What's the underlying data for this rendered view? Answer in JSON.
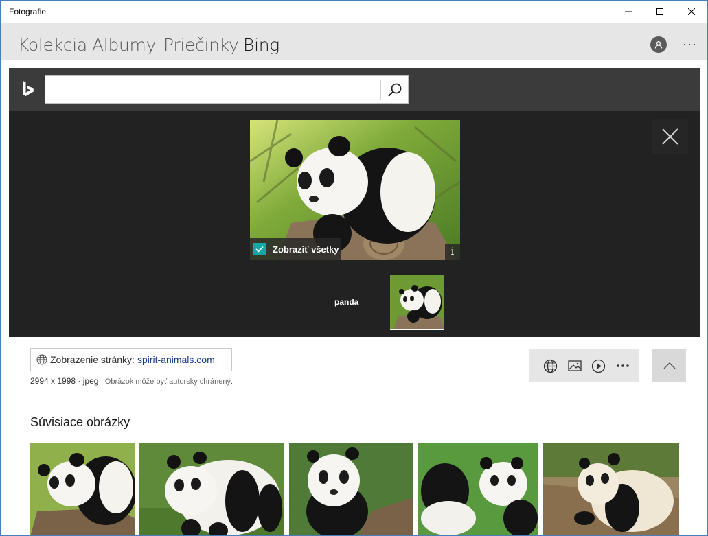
{
  "window": {
    "title": "Fotografie",
    "controls": [
      "minimize-icon",
      "maximize-icon",
      "close-icon"
    ]
  },
  "nav": {
    "tabs": [
      {
        "label": "Kolekcia",
        "active": false
      },
      {
        "label": "Albumy",
        "active": false
      },
      {
        "label": "Priečinky",
        "active": false
      },
      {
        "label": "Bing",
        "active": true
      }
    ],
    "avatar_icon": "user-icon",
    "more_label": "···"
  },
  "search": {
    "value": "",
    "placeholder": "",
    "button_icon": "search-icon",
    "logo_icon": "bing-logo-icon"
  },
  "viewer": {
    "main_image": "panda-on-log",
    "show_all_label": "Zobraziť všetky",
    "show_all_checked": true,
    "info_label": "i",
    "query_label": "panda",
    "close_icon": "close-icon"
  },
  "details": {
    "page_link_prefix": "Zobrazenie stránky:",
    "page_link_domain": "spirit-animals.com",
    "dimensions": "2994 x 1998 · jpeg",
    "copyright_note": "Obrázok môže byť autorsky chránený.",
    "actions": [
      "globe-icon",
      "image-icon",
      "play-icon",
      "more-icon"
    ],
    "collapse_icon": "chevron-up-icon"
  },
  "related": {
    "title": "Súvisiace obrázky",
    "images": [
      "panda-on-log",
      "panda-standing",
      "panda-sitting",
      "panda-playing",
      "panda-cub"
    ]
  },
  "colors": {
    "accent": "#14a8a4",
    "viewer_bg": "#222222",
    "bingbar_bg": "#3b3b3b",
    "nav_bg": "#e6e6e6",
    "link": "#1a3a8a"
  }
}
